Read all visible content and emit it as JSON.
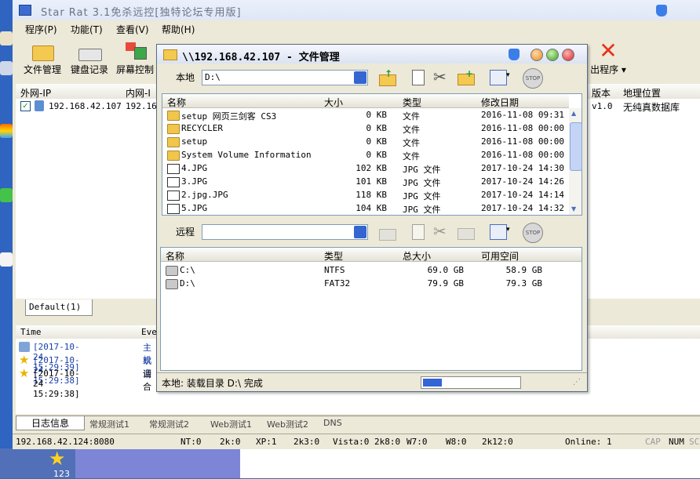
{
  "main_window": {
    "title": "Star Rat 3.1免杀远控[独特论坛专用版]",
    "menu": [
      "程序(P)",
      "功能(T)",
      "查看(V)",
      "帮助(H)"
    ],
    "toolbar": [
      "文件管理",
      "键盘记录",
      "屏幕控制",
      "出程序"
    ],
    "host_columns": [
      "外网-IP",
      "内网-I",
      "版本",
      "地理位置"
    ],
    "host_row": {
      "ext_ip": "192.168.42.107",
      "int_ip": "192.16",
      "version": "v1.0",
      "location": "无纯真数据库"
    },
    "group_tab": "Default(1)",
    "log_columns": [
      "Time",
      "Eve"
    ],
    "log_rows": [
      {
        "time": "[2017-10-24 15:29:39]",
        "event": "主机",
        "color": "#1a3ea8"
      },
      {
        "time": "[2017-10-24 15:29:38]",
        "event": "欢迎",
        "color": "#1a3ea8"
      },
      {
        "time": "[2017-10-24 15:29:38]",
        "event": "请合",
        "color": "#000000"
      }
    ],
    "bottom_tabs": [
      "日志信息",
      "常规测试1",
      "常规测试2",
      "Web测试1",
      "Web测试2",
      "DNS"
    ],
    "statusbar": [
      "192.168.42.124:8080",
      "NT:0",
      "2k:0",
      "XP:1",
      "2k3:0",
      "Vista:0 2k8:0",
      "W7:0",
      "W8:0",
      "2k12:0",
      "Online: 1",
      "CAP",
      "NUM",
      "SC"
    ]
  },
  "file_manager": {
    "title": "\\\\192.168.42.107 - 文件管理",
    "local_label": "本地",
    "local_path": "D:\\",
    "remote_label": "远程",
    "remote_path": "",
    "local_columns": [
      "名称",
      "大小",
      "类型",
      "修改日期"
    ],
    "local_files": [
      {
        "name": "setup 网页三剑客 CS3",
        "size": "0 KB",
        "type": "文件",
        "date": "2016-11-08 09:31",
        "icon": "folder"
      },
      {
        "name": "RECYCLER",
        "size": "0 KB",
        "type": "文件",
        "date": "2016-11-08 00:00",
        "icon": "folder"
      },
      {
        "name": "setup",
        "size": "0 KB",
        "type": "文件",
        "date": "2016-11-08 00:00",
        "icon": "folder"
      },
      {
        "name": "System Volume Information",
        "size": "0 KB",
        "type": "文件",
        "date": "2016-11-08 00:00",
        "icon": "folder"
      },
      {
        "name": "4.JPG",
        "size": "102 KB",
        "type": "JPG 文件",
        "date": "2017-10-24 14:30",
        "icon": "jpg"
      },
      {
        "name": "3.JPG",
        "size": "101 KB",
        "type": "JPG 文件",
        "date": "2017-10-24 14:26",
        "icon": "jpg"
      },
      {
        "name": "2.jpg.JPG",
        "size": "118 KB",
        "type": "JPG 文件",
        "date": "2017-10-24 14:14",
        "icon": "jpg"
      },
      {
        "name": "5.JPG",
        "size": "104 KB",
        "type": "JPG 文件",
        "date": "2017-10-24 14:32",
        "icon": "jpg"
      }
    ],
    "remote_columns": [
      "名称",
      "类型",
      "总大小",
      "可用空间"
    ],
    "remote_drives": [
      {
        "name": "C:\\",
        "type": "NTFS",
        "total": "69.0 GB",
        "free": "58.9 GB"
      },
      {
        "name": "D:\\",
        "type": "FAT32",
        "total": "79.9 GB",
        "free": "79.3 GB"
      }
    ],
    "status_text": "本地: 装载目录 D:\\ 完成",
    "progress_fraction": 0.2
  },
  "desktop": {
    "icon_label": "123"
  }
}
